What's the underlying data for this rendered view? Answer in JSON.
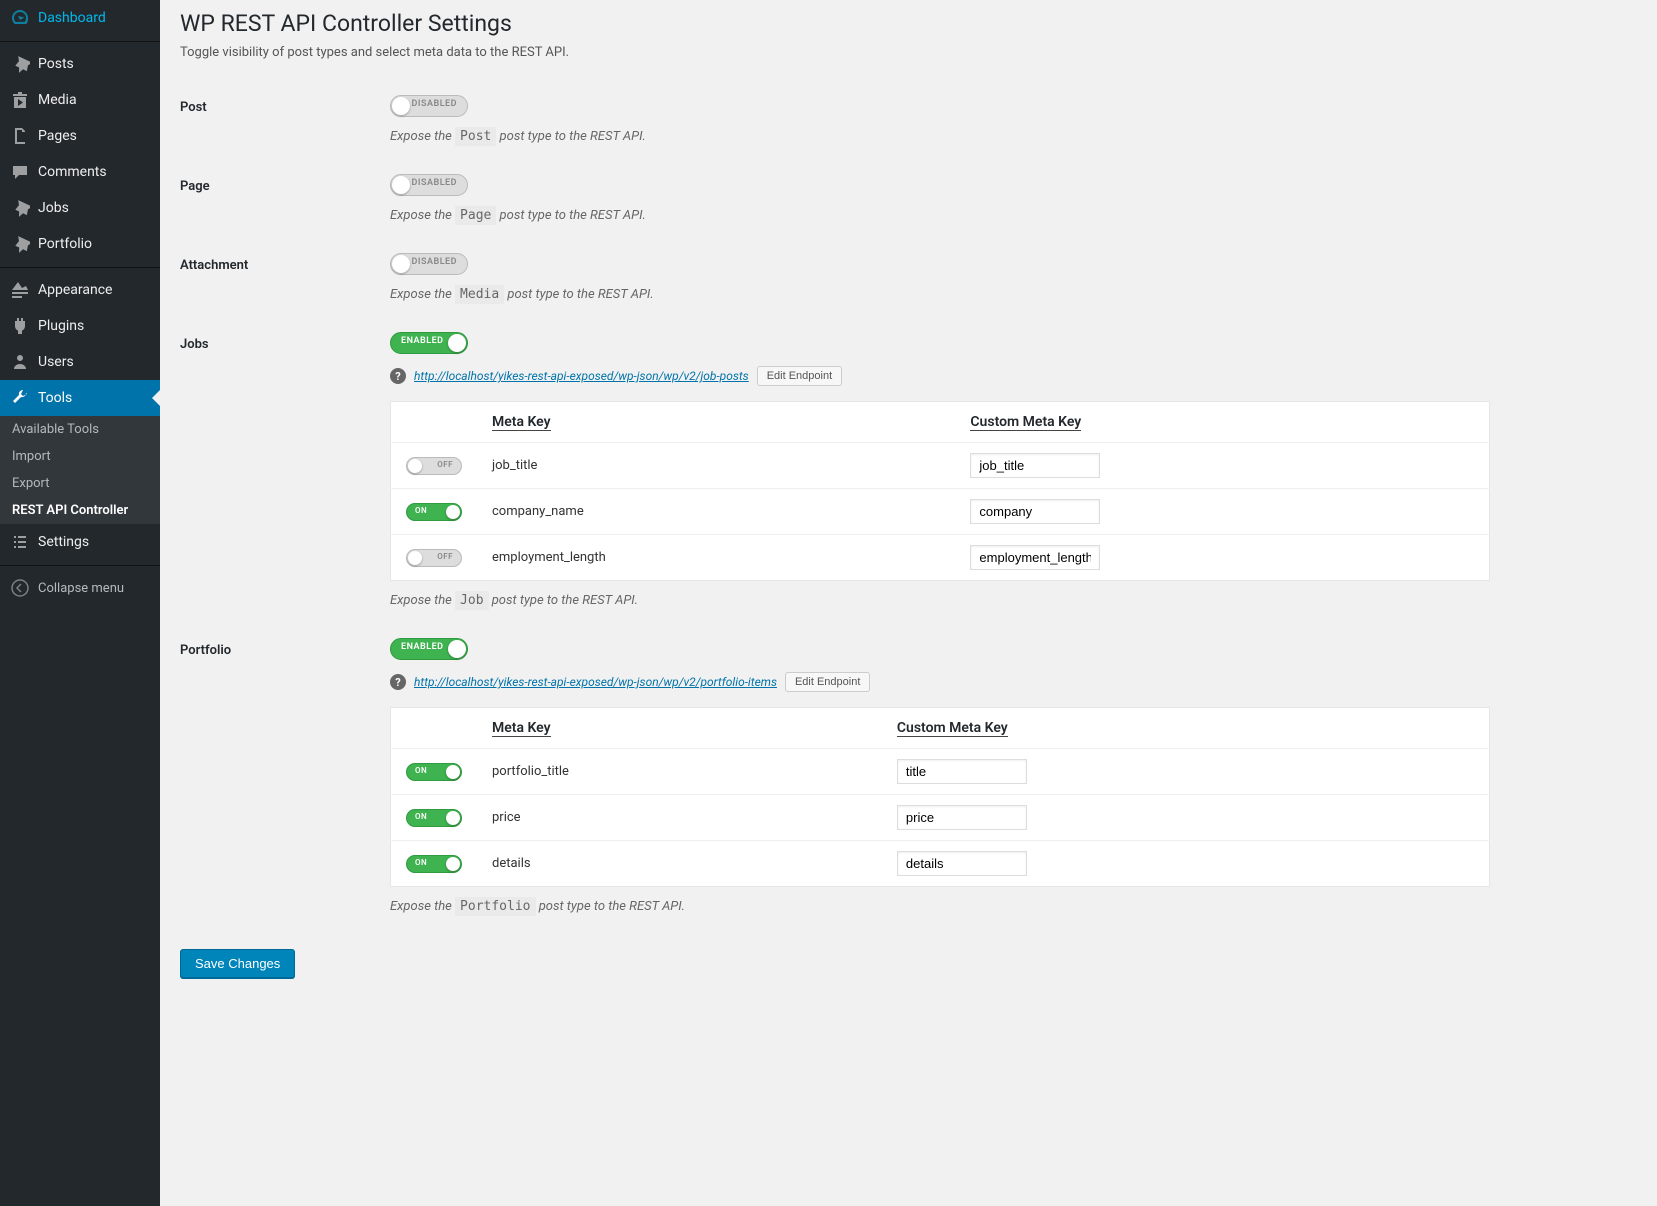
{
  "sidebar": {
    "items": [
      {
        "label": "Dashboard",
        "icon": "dashboard"
      },
      {
        "label": "Posts",
        "icon": "pin"
      },
      {
        "label": "Media",
        "icon": "media"
      },
      {
        "label": "Pages",
        "icon": "page"
      },
      {
        "label": "Comments",
        "icon": "comment"
      },
      {
        "label": "Jobs",
        "icon": "pin"
      },
      {
        "label": "Portfolio",
        "icon": "pin"
      },
      {
        "label": "Appearance",
        "icon": "appearance"
      },
      {
        "label": "Plugins",
        "icon": "plugin"
      },
      {
        "label": "Users",
        "icon": "users"
      },
      {
        "label": "Tools",
        "icon": "tools"
      },
      {
        "label": "Settings",
        "icon": "settings"
      }
    ],
    "submenu": [
      {
        "label": "Available Tools"
      },
      {
        "label": "Import"
      },
      {
        "label": "Export"
      },
      {
        "label": "REST API Controller"
      }
    ],
    "collapse": "Collapse menu"
  },
  "page": {
    "title": "WP REST API Controller Settings",
    "subtitle": "Toggle visibility of post types and select meta data to the REST API."
  },
  "labels": {
    "enabled": "ENABLED",
    "disabled": "DISABLED",
    "on": "ON",
    "off": "OFF",
    "meta_key": "Meta Key",
    "custom_meta_key": "Custom Meta Key",
    "edit_endpoint": "Edit Endpoint",
    "expose_pre": "Expose the ",
    "expose_post": " post type to the REST API.",
    "save": "Save Changes"
  },
  "post_types": [
    {
      "name": "Post",
      "enabled": false,
      "code": "Post"
    },
    {
      "name": "Page",
      "enabled": false,
      "code": "Page"
    },
    {
      "name": "Attachment",
      "enabled": false,
      "code": "Media"
    },
    {
      "name": "Jobs",
      "enabled": true,
      "endpoint": "http://localhost/yikes-rest-api-exposed/wp-json/wp/v2/job-posts",
      "code": "Job",
      "meta": [
        {
          "key": "job_title",
          "on": false,
          "custom": "job_title"
        },
        {
          "key": "company_name",
          "on": true,
          "custom": "company"
        },
        {
          "key": "employment_length",
          "on": false,
          "custom": "employment_length"
        }
      ]
    },
    {
      "name": "Portfolio",
      "enabled": true,
      "endpoint": "http://localhost/yikes-rest-api-exposed/wp-json/wp/v2/portfolio-items",
      "code": "Portfolio",
      "meta": [
        {
          "key": "portfolio_title",
          "on": true,
          "custom": "title"
        },
        {
          "key": "price",
          "on": true,
          "custom": "price"
        },
        {
          "key": "details",
          "on": true,
          "custom": "details"
        }
      ]
    }
  ]
}
